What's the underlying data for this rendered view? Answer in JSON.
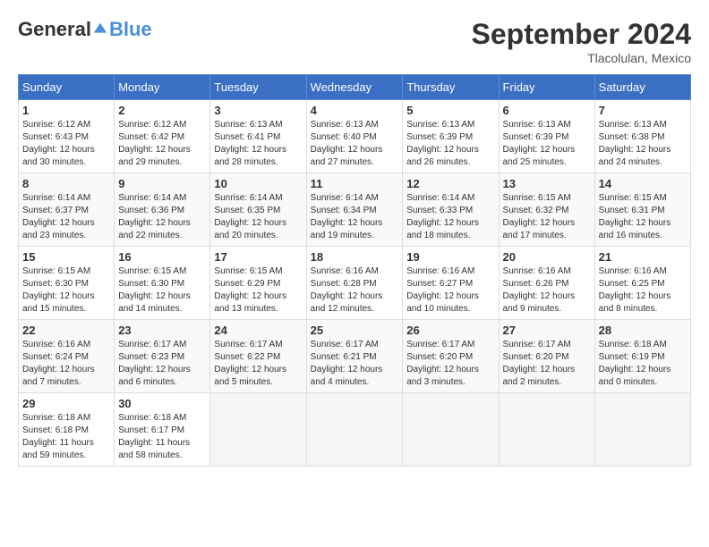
{
  "logo": {
    "general": "General",
    "blue": "Blue"
  },
  "title": "September 2024",
  "location": "Tlacolulan, Mexico",
  "days_header": [
    "Sunday",
    "Monday",
    "Tuesday",
    "Wednesday",
    "Thursday",
    "Friday",
    "Saturday"
  ],
  "weeks": [
    [
      {
        "day": "1",
        "info": "Sunrise: 6:12 AM\nSunset: 6:43 PM\nDaylight: 12 hours\nand 30 minutes."
      },
      {
        "day": "2",
        "info": "Sunrise: 6:12 AM\nSunset: 6:42 PM\nDaylight: 12 hours\nand 29 minutes."
      },
      {
        "day": "3",
        "info": "Sunrise: 6:13 AM\nSunset: 6:41 PM\nDaylight: 12 hours\nand 28 minutes."
      },
      {
        "day": "4",
        "info": "Sunrise: 6:13 AM\nSunset: 6:40 PM\nDaylight: 12 hours\nand 27 minutes."
      },
      {
        "day": "5",
        "info": "Sunrise: 6:13 AM\nSunset: 6:39 PM\nDaylight: 12 hours\nand 26 minutes."
      },
      {
        "day": "6",
        "info": "Sunrise: 6:13 AM\nSunset: 6:39 PM\nDaylight: 12 hours\nand 25 minutes."
      },
      {
        "day": "7",
        "info": "Sunrise: 6:13 AM\nSunset: 6:38 PM\nDaylight: 12 hours\nand 24 minutes."
      }
    ],
    [
      {
        "day": "8",
        "info": "Sunrise: 6:14 AM\nSunset: 6:37 PM\nDaylight: 12 hours\nand 23 minutes."
      },
      {
        "day": "9",
        "info": "Sunrise: 6:14 AM\nSunset: 6:36 PM\nDaylight: 12 hours\nand 22 minutes."
      },
      {
        "day": "10",
        "info": "Sunrise: 6:14 AM\nSunset: 6:35 PM\nDaylight: 12 hours\nand 20 minutes."
      },
      {
        "day": "11",
        "info": "Sunrise: 6:14 AM\nSunset: 6:34 PM\nDaylight: 12 hours\nand 19 minutes."
      },
      {
        "day": "12",
        "info": "Sunrise: 6:14 AM\nSunset: 6:33 PM\nDaylight: 12 hours\nand 18 minutes."
      },
      {
        "day": "13",
        "info": "Sunrise: 6:15 AM\nSunset: 6:32 PM\nDaylight: 12 hours\nand 17 minutes."
      },
      {
        "day": "14",
        "info": "Sunrise: 6:15 AM\nSunset: 6:31 PM\nDaylight: 12 hours\nand 16 minutes."
      }
    ],
    [
      {
        "day": "15",
        "info": "Sunrise: 6:15 AM\nSunset: 6:30 PM\nDaylight: 12 hours\nand 15 minutes."
      },
      {
        "day": "16",
        "info": "Sunrise: 6:15 AM\nSunset: 6:30 PM\nDaylight: 12 hours\nand 14 minutes."
      },
      {
        "day": "17",
        "info": "Sunrise: 6:15 AM\nSunset: 6:29 PM\nDaylight: 12 hours\nand 13 minutes."
      },
      {
        "day": "18",
        "info": "Sunrise: 6:16 AM\nSunset: 6:28 PM\nDaylight: 12 hours\nand 12 minutes."
      },
      {
        "day": "19",
        "info": "Sunrise: 6:16 AM\nSunset: 6:27 PM\nDaylight: 12 hours\nand 10 minutes."
      },
      {
        "day": "20",
        "info": "Sunrise: 6:16 AM\nSunset: 6:26 PM\nDaylight: 12 hours\nand 9 minutes."
      },
      {
        "day": "21",
        "info": "Sunrise: 6:16 AM\nSunset: 6:25 PM\nDaylight: 12 hours\nand 8 minutes."
      }
    ],
    [
      {
        "day": "22",
        "info": "Sunrise: 6:16 AM\nSunset: 6:24 PM\nDaylight: 12 hours\nand 7 minutes."
      },
      {
        "day": "23",
        "info": "Sunrise: 6:17 AM\nSunset: 6:23 PM\nDaylight: 12 hours\nand 6 minutes."
      },
      {
        "day": "24",
        "info": "Sunrise: 6:17 AM\nSunset: 6:22 PM\nDaylight: 12 hours\nand 5 minutes."
      },
      {
        "day": "25",
        "info": "Sunrise: 6:17 AM\nSunset: 6:21 PM\nDaylight: 12 hours\nand 4 minutes."
      },
      {
        "day": "26",
        "info": "Sunrise: 6:17 AM\nSunset: 6:20 PM\nDaylight: 12 hours\nand 3 minutes."
      },
      {
        "day": "27",
        "info": "Sunrise: 6:17 AM\nSunset: 6:20 PM\nDaylight: 12 hours\nand 2 minutes."
      },
      {
        "day": "28",
        "info": "Sunrise: 6:18 AM\nSunset: 6:19 PM\nDaylight: 12 hours\nand 0 minutes."
      }
    ],
    [
      {
        "day": "29",
        "info": "Sunrise: 6:18 AM\nSunset: 6:18 PM\nDaylight: 11 hours\nand 59 minutes."
      },
      {
        "day": "30",
        "info": "Sunrise: 6:18 AM\nSunset: 6:17 PM\nDaylight: 11 hours\nand 58 minutes."
      },
      null,
      null,
      null,
      null,
      null
    ]
  ]
}
